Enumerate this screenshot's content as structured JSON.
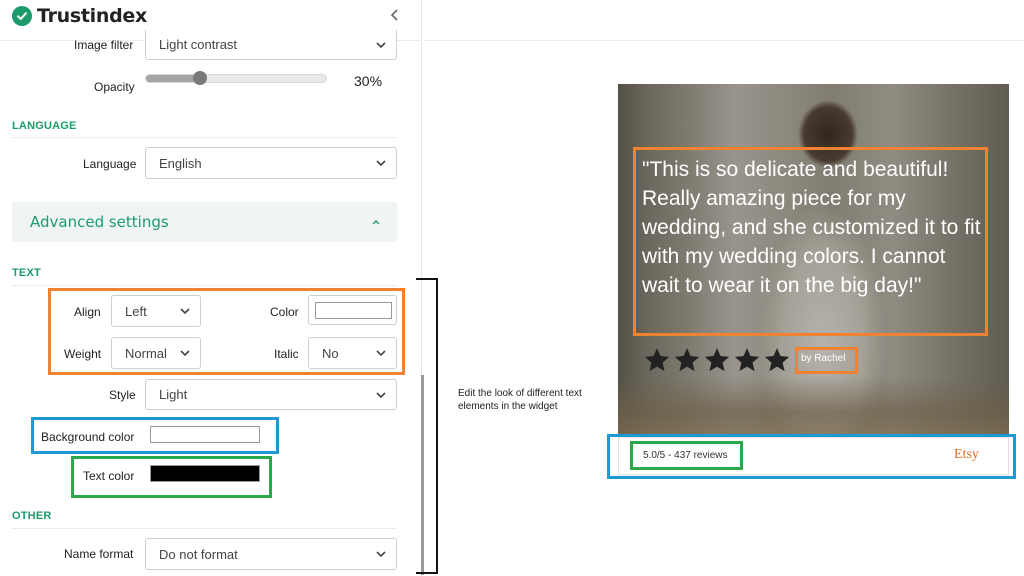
{
  "app": {
    "brand": "Trustindex"
  },
  "settings": {
    "image_filter": {
      "label": "Image filter",
      "value": "Light contrast"
    },
    "opacity": {
      "label": "Opacity",
      "value_text": "30%",
      "value": 0.3
    }
  },
  "language_section": {
    "title": "LANGUAGE",
    "language": {
      "label": "Language",
      "value": "English"
    }
  },
  "advanced": {
    "title": "Advanced settings"
  },
  "text_section": {
    "title": "TEXT",
    "align": {
      "label": "Align",
      "value": "Left"
    },
    "color": {
      "label": "Color",
      "swatch": "#ffffff"
    },
    "weight": {
      "label": "Weight",
      "value": "Normal"
    },
    "italic": {
      "label": "Italic",
      "value": "No"
    },
    "style": {
      "label": "Style",
      "value": "Light"
    },
    "background_color": {
      "label": "Background color",
      "swatch": "#ffffff"
    },
    "text_color": {
      "label": "Text color",
      "swatch": "#000000"
    }
  },
  "other_section": {
    "title": "OTHER",
    "name_format": {
      "label": "Name format",
      "value": "Do not format"
    }
  },
  "annotation": {
    "text": "Edit the look of different text elements in the widget"
  },
  "widget": {
    "review_text": "\"This is so delicate and beautiful! Really amazing piece for my wedding, and she customized it to fit with my wedding colors. I cannot wait to wear it on the big day!\"",
    "stars": 5,
    "reviewer": "by Rachel",
    "rating_summary": "5.0/5 - 437 reviews",
    "platform": "Etsy"
  },
  "colors": {
    "accent": "#1c9c6a",
    "annotation_orange": "#f08232",
    "annotation_blue": "#1d9ad6",
    "annotation_green": "#2aa84a",
    "platform": "#e9661d"
  }
}
